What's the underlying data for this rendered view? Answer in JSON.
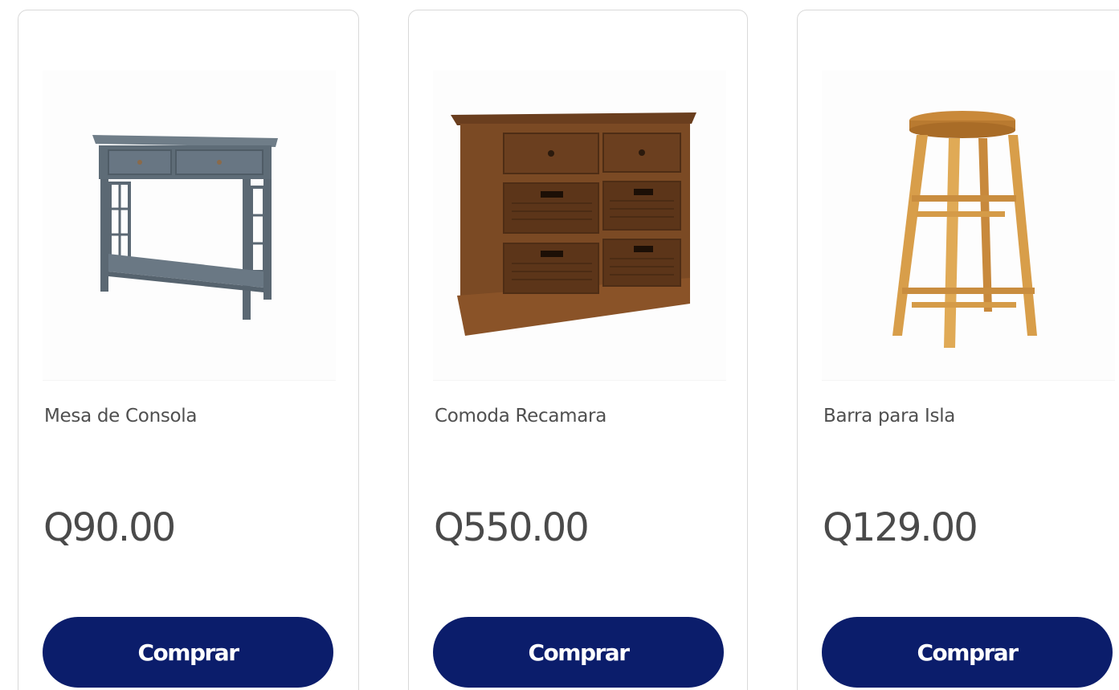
{
  "products": [
    {
      "name": "Mesa de Consola",
      "price": "Q90.00",
      "button_label": "Comprar",
      "image_icon": "console-table-image",
      "image_color": "#6d7c87"
    },
    {
      "name": "Comoda Recamara",
      "price": "Q550.00",
      "button_label": "Comprar",
      "image_icon": "dresser-image",
      "image_color": "#7a4a24"
    },
    {
      "name": "Barra para Isla",
      "price": "Q129.00",
      "button_label": "Comprar",
      "image_icon": "bar-stool-image",
      "image_color": "#d8a04a"
    }
  ],
  "colors": {
    "button_bg": "#0b1d6b",
    "button_text": "#ffffff",
    "text": "#4f4f4f",
    "border": "#d9d9d9"
  }
}
